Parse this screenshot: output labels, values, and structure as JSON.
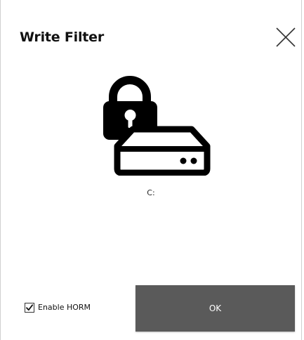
{
  "dialog": {
    "title": "Write Filter",
    "close_icon": "close-x-icon"
  },
  "drive": {
    "icon": "locked-drive-icon",
    "letter": "C:",
    "locked": true
  },
  "options": {
    "enable_horm": {
      "label": "Enable HORM",
      "checked": true
    }
  },
  "actions": {
    "ok_label": "OK",
    "ok_background": "#5a5a5a",
    "ok_text_color": "#ffffff"
  }
}
